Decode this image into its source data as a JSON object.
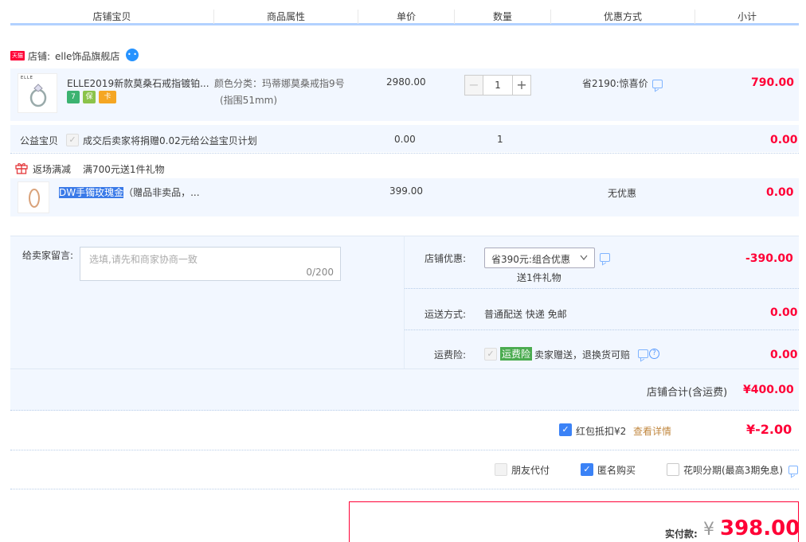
{
  "header": {
    "columns": [
      "店铺宝贝",
      "商品属性",
      "单价",
      "数量",
      "优惠方式",
      "小计"
    ]
  },
  "shop": {
    "badge": "天猫",
    "label": "店铺:",
    "name": "elle饰品旗舰店",
    "msg": "• •"
  },
  "item1": {
    "thumb_text": "ELLE",
    "title": "ELLE2019新款莫桑石戒指镀铂...",
    "tags": [
      "7",
      "保",
      "卡"
    ],
    "attr1": "颜色分类：玛蒂娜莫桑戒指9号",
    "attr2": "(指围51mm)",
    "price": "2980.00",
    "qty_minus": "−",
    "qty": "1",
    "qty_plus": "+",
    "discount": "省2190:惊喜价",
    "subtotal": "790.00"
  },
  "charity": {
    "label": "公益宝贝",
    "check": "✓",
    "text": "成交后卖家将捐赠0.02元给公益宝贝计划",
    "price": "0.00",
    "qty": "1",
    "subtotal": "0.00"
  },
  "promo": {
    "label": "返场满减",
    "text": "满700元送1件礼物"
  },
  "item2": {
    "title_hl": "DW手镯玫瑰金",
    "title_rest": "（赠品非卖品，...",
    "price": "399.00",
    "discount": "无优惠",
    "subtotal": "0.00"
  },
  "message": {
    "label": "给卖家留言:",
    "placeholder": "选填,请先和商家协商一致",
    "counter": "0/200"
  },
  "store_discount": {
    "label": "店铺优惠:",
    "selected": "省390元:组合优惠",
    "sub": "送1件礼物",
    "amount": "-390.00"
  },
  "shipping": {
    "label": "运送方式:",
    "value": "普通配送 快递 免邮",
    "amount": "0.00"
  },
  "insurance": {
    "label": "运费险:",
    "check": "✓",
    "tag": "运费险",
    "text": "卖家赠送，退换货可赔",
    "qmark": "?",
    "amount": "0.00"
  },
  "store_total": {
    "label": "店铺合计(含运费)",
    "amount": "¥400.00"
  },
  "redpacket": {
    "check": "✓",
    "label": "红包抵扣¥2",
    "link": "查看详情",
    "amount": "¥-2.00"
  },
  "options": {
    "friend": "朋友代付",
    "anon_check": "✓",
    "anon": "匿名购买",
    "huabei": "花呗分期(最高3期免息)"
  },
  "payment": {
    "label": "实付款:",
    "currency": "¥",
    "amount": "398.00"
  },
  "colors": {
    "accent_red": "#ff0036",
    "accent_blue": "#3b82f6",
    "row_bg": "#f2f7ff",
    "link_orange": "#c1873f"
  }
}
